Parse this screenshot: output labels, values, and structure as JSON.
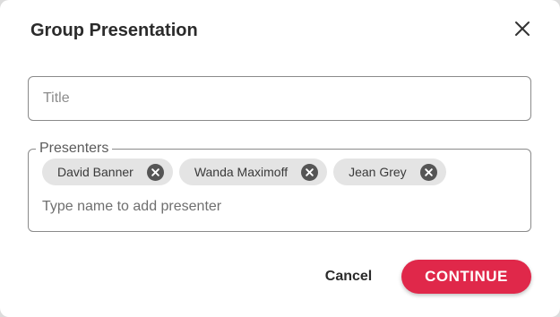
{
  "dialog": {
    "title": "Group Presentation",
    "close_icon": "close-icon"
  },
  "title_field": {
    "value": "",
    "placeholder": "Title"
  },
  "presenters": {
    "legend": "Presenters",
    "chips": [
      {
        "name": "David Banner",
        "remove_icon": "remove-circle-icon"
      },
      {
        "name": "Wanda Maximoff",
        "remove_icon": "remove-circle-icon"
      },
      {
        "name": "Jean Grey",
        "remove_icon": "remove-circle-icon"
      }
    ],
    "input_value": "",
    "input_placeholder": "Type name to add presenter"
  },
  "actions": {
    "cancel_label": "Cancel",
    "continue_label": "CONTINUE"
  },
  "colors": {
    "accent": "#e0284a",
    "chip_bg": "#e4e4e4",
    "chip_icon": "#555555",
    "border": "#8a8a8a"
  }
}
